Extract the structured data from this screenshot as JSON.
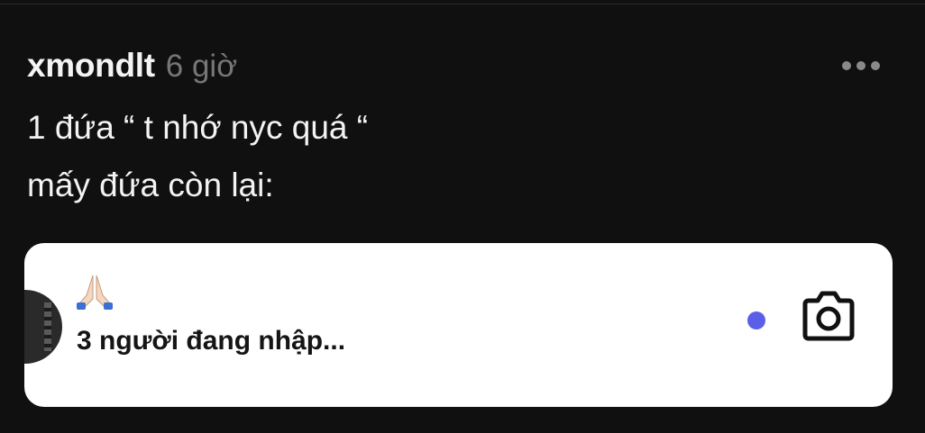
{
  "post": {
    "username": "xmondlt",
    "time": "6 giờ",
    "lines": [
      "1 đứa “ t nhớ nyc quá “",
      "mấy đứa còn lại:"
    ]
  },
  "card": {
    "emoji": "🙏🏻",
    "typing_text": "3 người đang nhập...",
    "status_dot_color": "#5b5fe8",
    "camera_icon": "camera-icon"
  },
  "colors": {
    "background": "#101010",
    "username": "#f4f4f4",
    "timestamp": "#777777"
  }
}
